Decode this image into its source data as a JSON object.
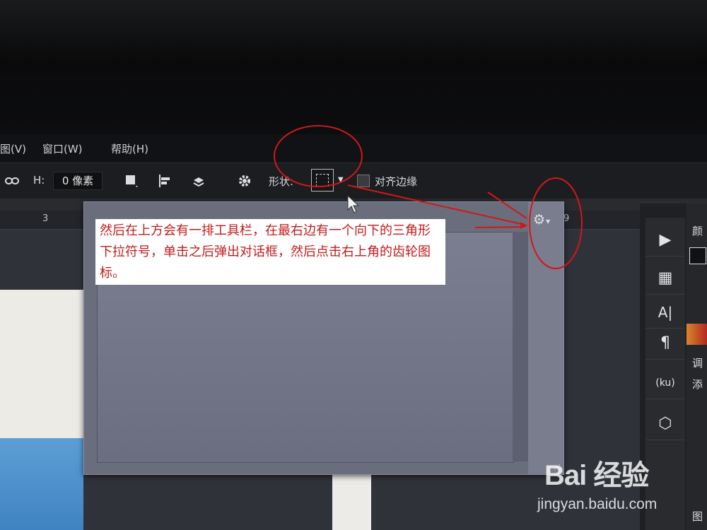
{
  "menubar": {
    "items": [
      {
        "label": "图(V)"
      },
      {
        "label": "窗口(W)"
      },
      {
        "label": "帮助(H)"
      }
    ]
  },
  "optionsbar": {
    "link_icon": "link-icon",
    "h_label": "H:",
    "h_value": "0 像素",
    "shape_label": "形状:",
    "align_edges_label": "对齐边缘",
    "gear_icon": "gear-icon"
  },
  "ruler": {
    "ticks": [
      "3",
      "9"
    ]
  },
  "annotation": {
    "text": "然后在上方会有一排工具栏，在最右边有一个向下的三角形下拉符号，单击之后弹出对话框，然后点击右上角的齿轮图标。",
    "color": "#c21a1a"
  },
  "right_panel": {
    "labels": [
      "颜",
      "调",
      "添",
      "图"
    ]
  },
  "watermark": {
    "brand": "Bai 经验",
    "url": "jingyan.baidu.com"
  }
}
